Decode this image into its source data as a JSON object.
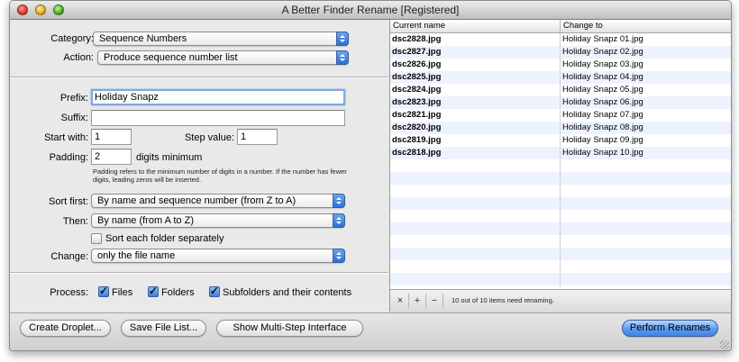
{
  "window": {
    "title": "A Better Finder Rename [Registered]"
  },
  "left": {
    "category": {
      "label": "Category:",
      "value": "Sequence Numbers"
    },
    "action": {
      "label": "Action:",
      "value": "Produce sequence number list"
    },
    "prefix": {
      "label": "Prefix:",
      "value": "Holiday Snapz"
    },
    "suffix": {
      "label": "Suffix:",
      "value": ""
    },
    "start_with": {
      "label": "Start with:",
      "value": "1"
    },
    "step_value": {
      "label": "Step value:",
      "value": "1"
    },
    "padding": {
      "label": "Padding:",
      "value": "2",
      "unit": "digits minimum"
    },
    "padding_note": "Padding refers to the minimum number of digits in a number. If the number has fewer digits, leading zeros will be inserted.",
    "sort_first": {
      "label": "Sort first:",
      "value": "By name and sequence number (from Z to A)"
    },
    "then": {
      "label": "Then:",
      "value": "By name (from A to Z)"
    },
    "sort_each_folder": {
      "label": "Sort each folder separately",
      "checked": false
    },
    "change": {
      "label": "Change:",
      "value": "only the file name"
    },
    "process": {
      "label": "Process:",
      "files": {
        "label": "Files",
        "checked": true
      },
      "folders": {
        "label": "Folders",
        "checked": true
      },
      "subfolders": {
        "label": "Subfolders and their contents",
        "checked": true
      }
    }
  },
  "table": {
    "headers": {
      "current": "Current name",
      "change": "Change to"
    },
    "rows": [
      {
        "current": "dsc2828.jpg",
        "change": "Holiday Snapz 01.jpg"
      },
      {
        "current": "dsc2827.jpg",
        "change": "Holiday Snapz 02.jpg"
      },
      {
        "current": "dsc2826.jpg",
        "change": "Holiday Snapz 03.jpg"
      },
      {
        "current": "dsc2825.jpg",
        "change": "Holiday Snapz 04.jpg"
      },
      {
        "current": "dsc2824.jpg",
        "change": "Holiday Snapz 05.jpg"
      },
      {
        "current": "dsc2823.jpg",
        "change": "Holiday Snapz 06.jpg"
      },
      {
        "current": "dsc2821.jpg",
        "change": "Holiday Snapz 07.jpg"
      },
      {
        "current": "dsc2820.jpg",
        "change": "Holiday Snapz 08.jpg"
      },
      {
        "current": "dsc2819.jpg",
        "change": "Holiday Snapz 09.jpg"
      },
      {
        "current": "dsc2818.jpg",
        "change": "Holiday Snapz 10.jpg"
      }
    ],
    "footer": {
      "remove": "×",
      "add": "+",
      "minus": "−",
      "status": "10 out of 10 items need renaming."
    }
  },
  "buttons": {
    "create_droplet": "Create Droplet...",
    "save_file_list": "Save File List...",
    "multi_step": "Show Multi-Step Interface",
    "perform": "Perform Renames"
  }
}
